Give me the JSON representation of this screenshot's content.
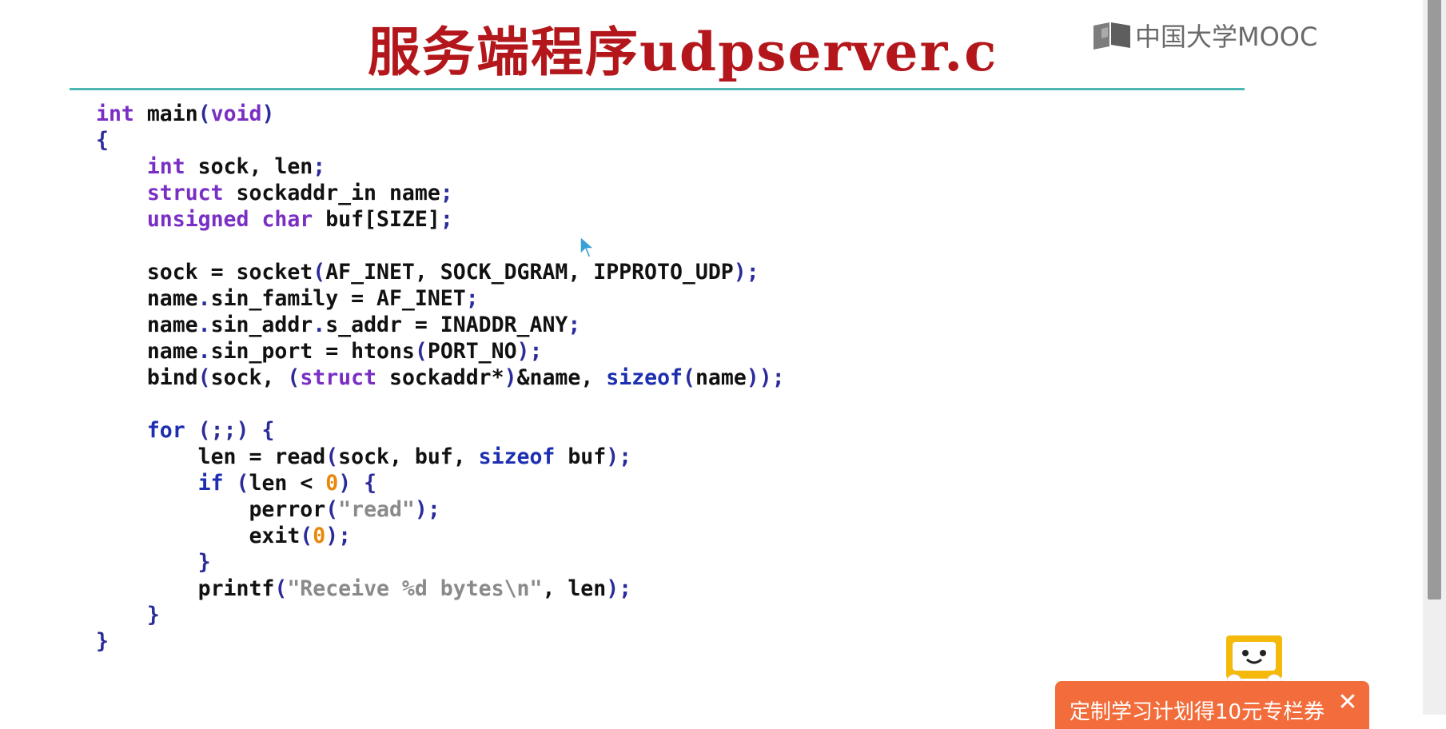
{
  "slide": {
    "title": "服务端程序udpserver.c",
    "logo_text": "中国大学MOOC",
    "code_lines": [
      [
        {
          "t": "int",
          "c": "kw"
        },
        {
          "t": " main"
        },
        {
          "t": "(",
          "c": "punc"
        },
        {
          "t": "void",
          "c": "kw"
        },
        {
          "t": ")",
          "c": "punc"
        }
      ],
      [
        {
          "t": "{",
          "c": "punc"
        }
      ],
      [
        {
          "t": "    "
        },
        {
          "t": "int",
          "c": "kw"
        },
        {
          "t": " sock, len"
        },
        {
          "t": ";",
          "c": "punc"
        }
      ],
      [
        {
          "t": "    "
        },
        {
          "t": "struct",
          "c": "kw"
        },
        {
          "t": " sockaddr_in name"
        },
        {
          "t": ";",
          "c": "punc"
        }
      ],
      [
        {
          "t": "    "
        },
        {
          "t": "unsigned",
          "c": "kw"
        },
        {
          "t": " "
        },
        {
          "t": "char",
          "c": "kw"
        },
        {
          "t": " buf[SIZE]"
        },
        {
          "t": ";",
          "c": "punc"
        }
      ],
      [],
      [
        {
          "t": "    sock = socket"
        },
        {
          "t": "(",
          "c": "punc"
        },
        {
          "t": "AF_INET, SOCK_DGRAM, IPPROTO_UDP"
        },
        {
          "t": ");",
          "c": "punc"
        }
      ],
      [
        {
          "t": "    name"
        },
        {
          "t": ".",
          "c": "punc"
        },
        {
          "t": "sin_family = AF_INET"
        },
        {
          "t": ";",
          "c": "punc"
        }
      ],
      [
        {
          "t": "    name"
        },
        {
          "t": ".",
          "c": "punc"
        },
        {
          "t": "sin_addr"
        },
        {
          "t": ".",
          "c": "punc"
        },
        {
          "t": "s_addr = INADDR_ANY"
        },
        {
          "t": ";",
          "c": "punc"
        }
      ],
      [
        {
          "t": "    name"
        },
        {
          "t": ".",
          "c": "punc"
        },
        {
          "t": "sin_port = htons"
        },
        {
          "t": "(",
          "c": "punc"
        },
        {
          "t": "PORT_NO"
        },
        {
          "t": ");",
          "c": "punc"
        }
      ],
      [
        {
          "t": "    bind"
        },
        {
          "t": "(",
          "c": "punc"
        },
        {
          "t": "sock, "
        },
        {
          "t": "(",
          "c": "punc"
        },
        {
          "t": "struct",
          "c": "kw"
        },
        {
          "t": " sockaddr*"
        },
        {
          "t": ")",
          "c": "punc"
        },
        {
          "t": "&name, "
        },
        {
          "t": "sizeof",
          "c": "kw2"
        },
        {
          "t": "(",
          "c": "punc"
        },
        {
          "t": "name"
        },
        {
          "t": "));",
          "c": "punc"
        }
      ],
      [],
      [
        {
          "t": "    "
        },
        {
          "t": "for",
          "c": "kw2"
        },
        {
          "t": " "
        },
        {
          "t": "(;;)",
          "c": "punc"
        },
        {
          "t": " "
        },
        {
          "t": "{",
          "c": "punc"
        }
      ],
      [
        {
          "t": "        len = read"
        },
        {
          "t": "(",
          "c": "punc"
        },
        {
          "t": "sock, buf, "
        },
        {
          "t": "sizeof",
          "c": "kw2"
        },
        {
          "t": " buf"
        },
        {
          "t": ");",
          "c": "punc"
        }
      ],
      [
        {
          "t": "        "
        },
        {
          "t": "if",
          "c": "kw2"
        },
        {
          "t": " "
        },
        {
          "t": "(",
          "c": "punc"
        },
        {
          "t": "len < "
        },
        {
          "t": "0",
          "c": "num"
        },
        {
          "t": ")",
          "c": "punc"
        },
        {
          "t": " "
        },
        {
          "t": "{",
          "c": "punc"
        }
      ],
      [
        {
          "t": "            perror"
        },
        {
          "t": "(",
          "c": "punc"
        },
        {
          "t": "\"read\"",
          "c": "str"
        },
        {
          "t": ");",
          "c": "punc"
        }
      ],
      [
        {
          "t": "            exit"
        },
        {
          "t": "(",
          "c": "punc"
        },
        {
          "t": "0",
          "c": "num"
        },
        {
          "t": ");",
          "c": "punc"
        }
      ],
      [
        {
          "t": "        "
        },
        {
          "t": "}",
          "c": "punc"
        }
      ],
      [
        {
          "t": "        printf"
        },
        {
          "t": "(",
          "c": "punc"
        },
        {
          "t": "\"Receive %d bytes\\n\"",
          "c": "str"
        },
        {
          "t": ", len"
        },
        {
          "t": ");",
          "c": "punc"
        }
      ],
      [
        {
          "t": "    "
        },
        {
          "t": "}",
          "c": "punc"
        }
      ],
      [
        {
          "t": "}",
          "c": "punc"
        }
      ]
    ]
  },
  "promo": {
    "text": "定制学习计划得10元专栏券",
    "close_symbol": "✕",
    "color": "#f26d3b"
  },
  "colors": {
    "title": "#b3171b",
    "rule": "#4db7b2",
    "keyword": "#7a2fc4",
    "keyword_flow": "#1d2fb0",
    "number": "#e8880b",
    "string": "#8a8a8a"
  }
}
